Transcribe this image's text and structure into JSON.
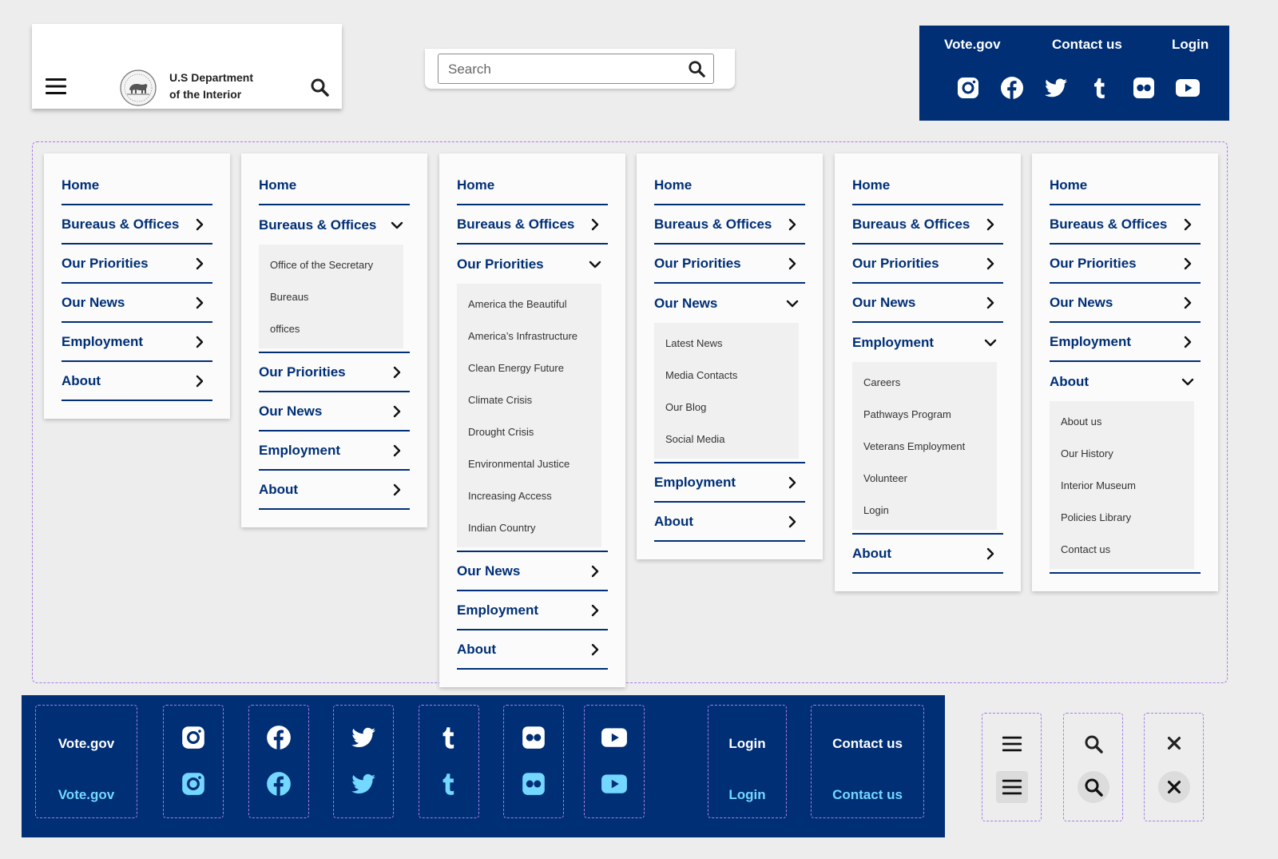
{
  "header": {
    "agency_line1": "U.S Department",
    "agency_line2": "of the Interior"
  },
  "search": {
    "placeholder": "Search"
  },
  "utility": {
    "vote": "Vote.gov",
    "contact": "Contact us",
    "login": "Login"
  },
  "menus": [
    {
      "items": [
        "Home",
        "Bureaus & Offices",
        "Our Priorities",
        "Our News",
        "Employment",
        "About"
      ],
      "expanded": -1,
      "sub": []
    },
    {
      "items": [
        "Home",
        "Bureaus & Offices",
        "Our Priorities",
        "Our News",
        "Employment",
        "About"
      ],
      "expanded": 1,
      "sub": [
        "Office of the Secretary",
        "Bureaus",
        "offices"
      ]
    },
    {
      "items": [
        "Home",
        "Bureaus & Offices",
        "Our Priorities",
        "Our News",
        "Employment",
        "About"
      ],
      "expanded": 2,
      "sub": [
        "America the Beautiful",
        "America’s Infrastructure",
        "Clean Energy Future",
        "Climate Crisis",
        "Drought Crisis",
        "Environmental Justice",
        "Increasing Access",
        "Indian Country"
      ]
    },
    {
      "items": [
        "Home",
        "Bureaus & Offices",
        "Our Priorities",
        "Our News",
        "Employment",
        "About"
      ],
      "expanded": 3,
      "sub": [
        "Latest News",
        "Media Contacts",
        "Our Blog",
        "Social Media"
      ]
    },
    {
      "items": [
        "Home",
        "Bureaus & Offices",
        "Our Priorities",
        "Our News",
        "Employment",
        "About"
      ],
      "expanded": 4,
      "sub": [
        "Careers",
        "Pathways Program",
        "Veterans Employment",
        "Volunteer",
        "Login"
      ]
    },
    {
      "items": [
        "Home",
        "Bureaus & Offices",
        "Our Priorities",
        "Our News",
        "Employment",
        "About"
      ],
      "expanded": 5,
      "sub": [
        "About us",
        "Our History",
        "Interior Museum",
        "Policies Library",
        "Contact us"
      ]
    }
  ],
  "footer": {
    "vote": "Vote.gov",
    "vote_hover": "Vote.gov",
    "login": "Login",
    "login_hover": "Login",
    "contact": "Contact us",
    "contact_hover": "Contact us"
  },
  "colors": {
    "navy": "#002f76",
    "hover_cyan": "#73d7ff",
    "dash": "#a77de8",
    "background": "#ededed"
  },
  "icons": [
    "menu-icon",
    "seal-icon",
    "search-icon",
    "instagram-icon",
    "facebook-icon",
    "twitter-icon",
    "tumblr-icon",
    "flickr-icon",
    "youtube-icon",
    "close-icon",
    "chevron-right-icon",
    "chevron-down-icon"
  ]
}
